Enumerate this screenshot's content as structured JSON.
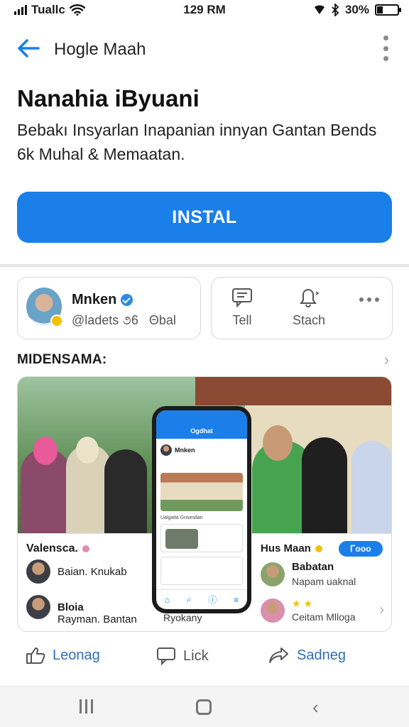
{
  "status_bar": {
    "carrier": "Tuallc",
    "time": "129 RM",
    "battery": "30%",
    "battery_level": 0.3
  },
  "app_bar": {
    "title": "Hogle Maah"
  },
  "app": {
    "name": "Nanahia iByuani",
    "description": "Bebakı Insyarlan Inapanian innyan Gantan Bends 6k Muhal & Memaatan.",
    "install_label": "INSTAL"
  },
  "profile": {
    "name": "Mnken",
    "handle": "@ladets ૭6",
    "handle_extra": "Θbal"
  },
  "actions": {
    "tell": "Tell",
    "stach": "Stach"
  },
  "section": {
    "title": "MIDENSAMA:"
  },
  "hero": {
    "left_panel": {
      "title": "Valensca.",
      "items": [
        {
          "text": "Baian. Knukab"
        },
        {
          "text": "Bloia"
        },
        {
          "text": "Rayman. Bantan"
        }
      ]
    },
    "right_panel": {
      "title": "Hus Maan",
      "pill": "Ꮁooo",
      "items": [
        {
          "title": "Babatan",
          "sub": "Napam uaknal"
        },
        {
          "text": "Ceitam Mlloga"
        }
      ]
    },
    "phone": {
      "title": "Ogdhat",
      "profile": "Mnken",
      "caption": "Ualgaita Gnsesdan",
      "label": "Ryokany"
    }
  },
  "bottom_actions": {
    "like": "Leonag",
    "lick": "Lick",
    "share": "Sadneg"
  }
}
